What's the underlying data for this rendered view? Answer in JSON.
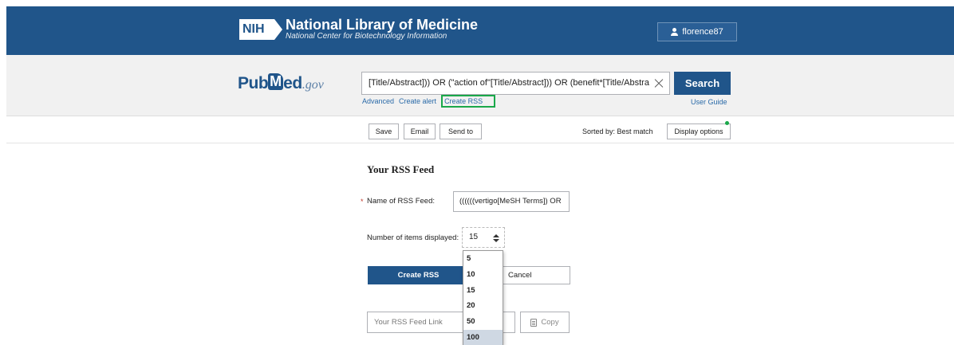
{
  "header": {
    "org_short": "NIH",
    "title": "National Library of Medicine",
    "subtitle": "National Center for Biotechnology Information",
    "username": "florence87"
  },
  "search": {
    "logo_pub": "Pub",
    "logo_m": "M",
    "logo_ed": "ed",
    "logo_gov": ".gov",
    "query": "[Title/Abstract])) OR (\"action of\"[Title/Abstract])) OR (benefit*[Title/Abstract]))",
    "button": "Search",
    "links": {
      "advanced": "Advanced",
      "create_alert": "Create alert",
      "create_rss": "Create RSS",
      "user_guide": "User Guide"
    },
    "highlight_color": "#1aa84a"
  },
  "toolbar": {
    "save": "Save",
    "email": "Email",
    "send_to": "Send to",
    "sorted_by": "Sorted by: Best match",
    "display_options": "Display options"
  },
  "rss_form": {
    "title": "Your RSS Feed",
    "required_mark": "*",
    "name_label": "Name of RSS Feed:",
    "name_value": "((((((vertigo[MeSH Terms]) OR",
    "items_label": "Number of items displayed:",
    "items_selected": "15",
    "items_options": [
      "5",
      "10",
      "15",
      "20",
      "50",
      "100"
    ],
    "items_hovered": "100",
    "create_button": "Create RSS",
    "cancel_button": "Cancel",
    "feed_link_placeholder": "Your RSS Feed Link",
    "copy_button": "Copy"
  },
  "colors": {
    "brand_blue": "#20558a",
    "search_band": "#f1f1f1"
  }
}
